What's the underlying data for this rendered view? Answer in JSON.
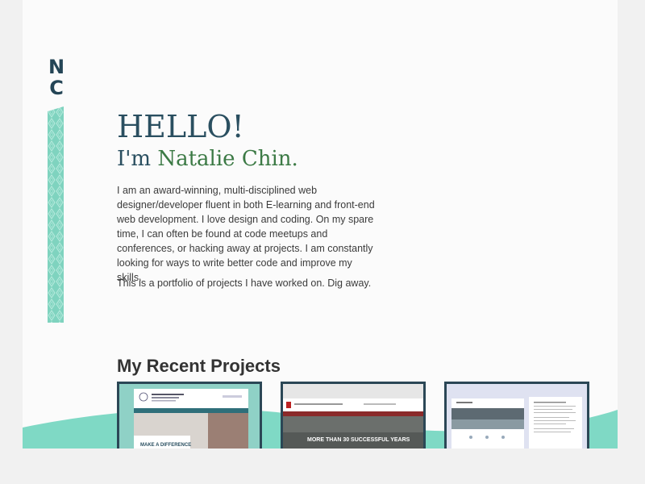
{
  "logo": {
    "letter1": "N",
    "letter2": "C"
  },
  "hero": {
    "greeting": "HELLO!",
    "intro_prefix": "I'm",
    "name": "Natalie Chin."
  },
  "bio": {
    "paragraph1": "I am an award-winning, multi-disciplined web designer/developer fluent in both E-learning and front-end web development. I love design and coding. On my spare time, I can often be found at code meetups and conferences, or hacking away at projects. I am constantly looking for ways to write better code and improve my skills.",
    "paragraph2": "This is a portfolio of projects I have worked on. Dig away."
  },
  "projects": {
    "heading": "My Recent Projects",
    "items": [
      {
        "caption": "MAKE A DIFFERENCE"
      },
      {
        "caption": "MORE THAN 30 SUCCESSFUL YEARS"
      },
      {
        "caption": ""
      }
    ]
  },
  "colors": {
    "accent_teal": "#7fd9c5",
    "navy": "#2a4f60",
    "green_name": "#3c7a45",
    "card_border": "#2b4756"
  }
}
